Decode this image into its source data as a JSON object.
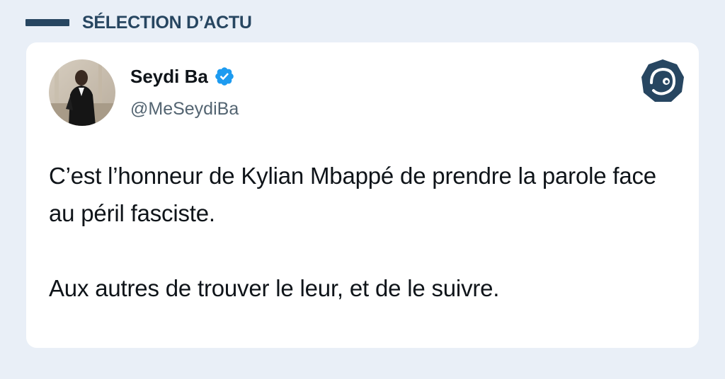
{
  "section": {
    "label": "SÉLECTION D’ACTU"
  },
  "tweet": {
    "author": {
      "display_name": "Seydi Ba",
      "handle": "@MeSeydiBa",
      "verified": true
    },
    "paragraphs": [
      "C’est l’honneur de Kylian Mbappé de prendre la parole face au péril fasciste.",
      "Aux autres de trouver le leur, et de le suivre."
    ]
  },
  "colors": {
    "page_background": "#e9eff7",
    "brand_navy": "#274661",
    "card_background": "#ffffff",
    "verified_blue": "#1d9bf0",
    "text_primary": "#0f1419",
    "text_secondary": "#536471"
  },
  "icons": {
    "verified": "verified-badge-icon",
    "brand": "brand-logo-icon"
  }
}
